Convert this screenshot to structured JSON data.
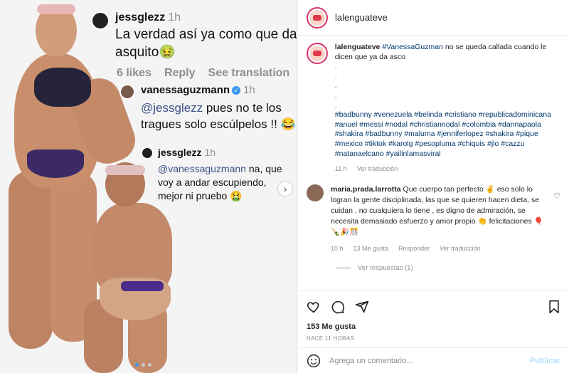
{
  "media": {
    "comment1": {
      "user": "jessglezz",
      "time": "1h",
      "text": "La verdad así ya como que da asquito🤢",
      "likes": "6 likes",
      "reply": "Reply",
      "see_translation": "See translation"
    },
    "comment2": {
      "user": "vanessaguzmann",
      "time": "1h",
      "mention": "@jessglezz",
      "text": " pues no te los tragues solo escúlpelos !! 😂"
    },
    "comment3": {
      "user": "jessglezz",
      "time": "1h",
      "mention": "@vanessaguzmann",
      "text": " na, que voy a andar escupiendo, mejor ni pruebo 🤮"
    }
  },
  "header": {
    "username": "lalenguateve"
  },
  "caption": {
    "username": "lalenguateve",
    "mention": "#VanessaGuzman",
    "text": " no se queda callada cuando le dicen que ya da asco",
    "dots": ".\n.\n.\n.\n.",
    "hashtags": "#badbunny #venezuela #belinda #cristiano #republicadominicana #anuel #messi #nodal #christiannodal #colombia #dannapaola #shakira #badbunny #maluma #jenniferlopez #shakira #pique #mexico #tiktok #karolg #pesopluma #chiquis #jlo #cazzu #natanaelcano #yailinlamasviral",
    "time": "11 h",
    "translate": "Ver traducción"
  },
  "comment": {
    "username": "maria.prada.larrotta",
    "text": " Que cuerpo tan perfecto ✌️ eso solo lo logran la gente disciplinada, las que se quieren hacen dieta, se cuidan , no cualquiera lo tiene , es digno de admiración, se necesita demasiado esfuerzo y amor propio 👏 felicitaciones 🎈🍾🎉🎊",
    "time": "10 h",
    "likes": "13 Me gusta",
    "reply": "Responder",
    "translate": "Ver traducción",
    "view_replies": "Ver respuestas (1)"
  },
  "actions": {
    "likes": "153 Me gusta",
    "ago": "HACE 11 HORAS"
  },
  "add_comment": {
    "placeholder": "Agrega un comentario...",
    "post": "Publicar"
  }
}
